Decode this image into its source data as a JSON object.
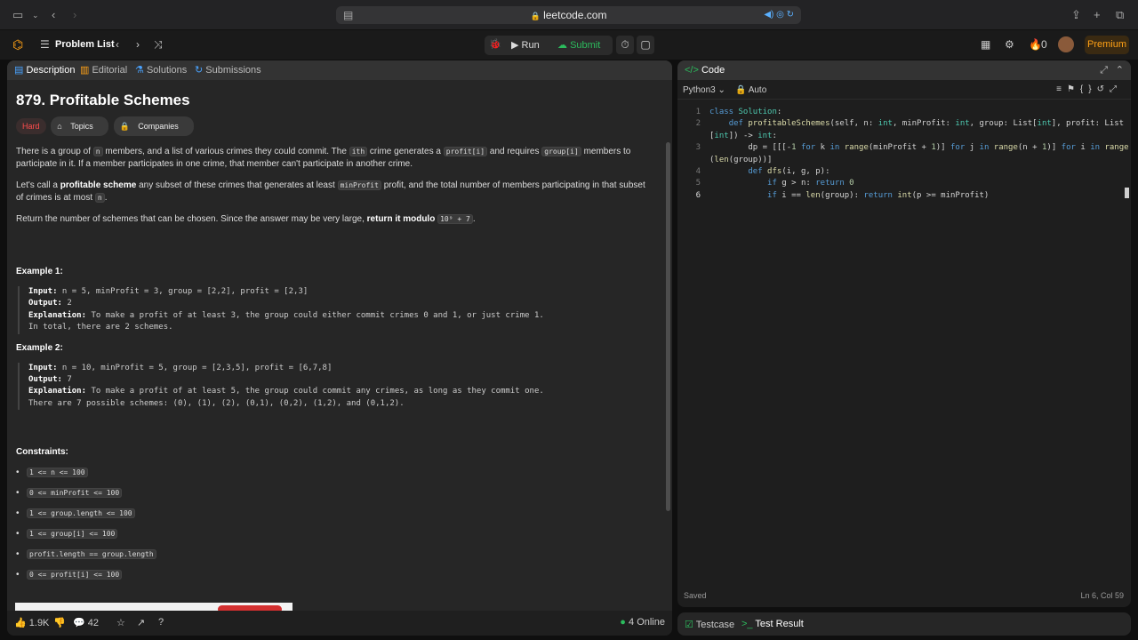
{
  "browser": {
    "url": "leetcode.com"
  },
  "appbar": {
    "problem_list": "Problem List",
    "run": "Run",
    "submit": "Submit",
    "fire_count": "0",
    "premium": "Premium"
  },
  "left": {
    "tabs": [
      "Description",
      "Editorial",
      "Solutions",
      "Submissions"
    ],
    "title": "879. Profitable Schemes",
    "tags": [
      "Hard",
      "Topics",
      "Companies"
    ],
    "p1a": "There is a group of ",
    "p1n": "n",
    "p1b": " members, and a list of various crimes they could commit. The ",
    "p1i": "ith",
    "p1c": " crime generates a ",
    "p1pi": "profit[i]",
    "p1d": " and requires ",
    "p1gi": "group[i]",
    "p1e": " members to participate in it. If a member participates in one crime, that member can't participate in another crime.",
    "p2a": "Let's call a ",
    "p2b": "profitable scheme",
    "p2c": " any subset of these crimes that generates at least ",
    "p2mp": "minProfit",
    "p2d": " profit, and the total number of members participating in that subset of crimes is at most ",
    "p2n": "n",
    "p2e": ".",
    "p3a": "Return the number of schemes that can be chosen. Since the answer may be very large, ",
    "p3b": "return it modulo",
    "p3mod": "10⁹ + 7",
    "p3c": ".",
    "ex1_title": "Example 1:",
    "ex1_input_label": "Input:",
    "ex1_input": " n = 5, minProfit = 3, group = [2,2], profit = [2,3]",
    "ex1_output_label": "Output:",
    "ex1_output": " 2",
    "ex1_expl_label": "Explanation:",
    "ex1_expl": " To make a profit of at least 3, the group could either commit crimes 0 and 1, or just crime 1.\nIn total, there are 2 schemes.",
    "ex2_title": "Example 2:",
    "ex2_input_label": "Input:",
    "ex2_input": " n = 10, minProfit = 5, group = [2,3,5], profit = [6,7,8]",
    "ex2_output_label": "Output:",
    "ex2_output": " 7",
    "ex2_expl_label": "Explanation:",
    "ex2_expl": " To make a profit of at least 5, the group could commit any crimes, as long as they commit one.\nThere are 7 possible schemes: (0), (1), (2), (0,1), (0,2), (1,2), and (0,1,2).",
    "constraints_title": "Constraints:",
    "constraints": [
      "1 <= n <= 100",
      "0 <= minProfit <= 100",
      "1 <= group.length <= 100",
      "1 <= group[i] <= 100",
      "profit.length == group.length",
      "0 <= profit[i] <= 100"
    ],
    "footer": {
      "likes": "1.9K",
      "comments": "42",
      "online": "4 Online"
    }
  },
  "right": {
    "tab": "Code",
    "lang": "Python3",
    "mode": "Auto",
    "lines": [
      "1",
      "2",
      "",
      "3",
      "",
      "4",
      "5",
      "6"
    ],
    "status": "Saved",
    "cursor": "Ln 6, Col 59",
    "bottom_tabs": [
      "Testcase",
      "Test Result"
    ]
  }
}
